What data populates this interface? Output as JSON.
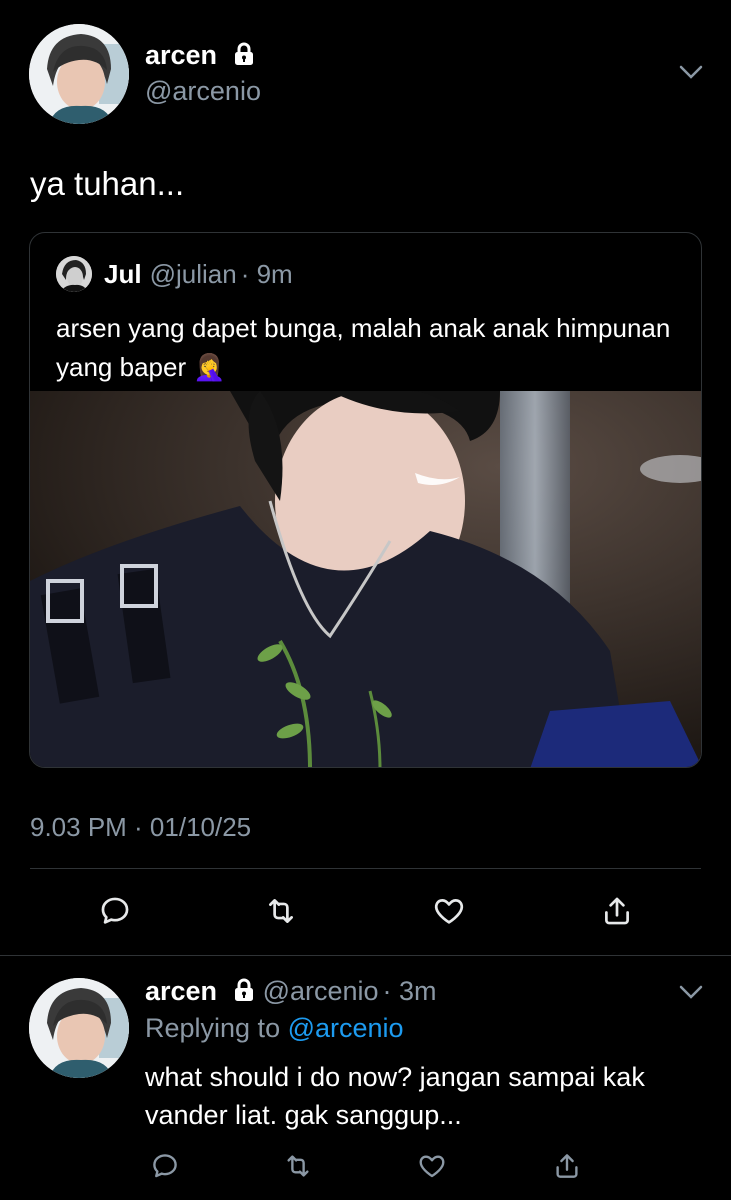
{
  "main_tweet": {
    "author_name": "arcen",
    "author_handle": "@arcenio",
    "text": "ya tuhan...",
    "timestamp": "9.03 PM · 01/10/25"
  },
  "quoted_tweet": {
    "author_name": "Jul",
    "author_handle": "@julian",
    "time": "· 9m",
    "text": "arsen yang dapet bunga, malah anak anak himpunan yang baper 🤦‍♀️"
  },
  "reply": {
    "author_name": "arcen",
    "author_handle": "@arcenio",
    "time": "· 3m",
    "replying_prefix": "Replying to",
    "replying_handle": "@arcenio",
    "text": "what should i do now? jangan sampai kak vander liat. gak sanggup..."
  },
  "icons": [
    "lock-icon",
    "chevron-down-icon",
    "reply-icon",
    "retweet-icon",
    "like-icon",
    "share-icon"
  ],
  "colors": {
    "background": "#000000",
    "secondary_text": "#8b98a5",
    "link": "#1d9bf0",
    "border": "#2f3336"
  }
}
